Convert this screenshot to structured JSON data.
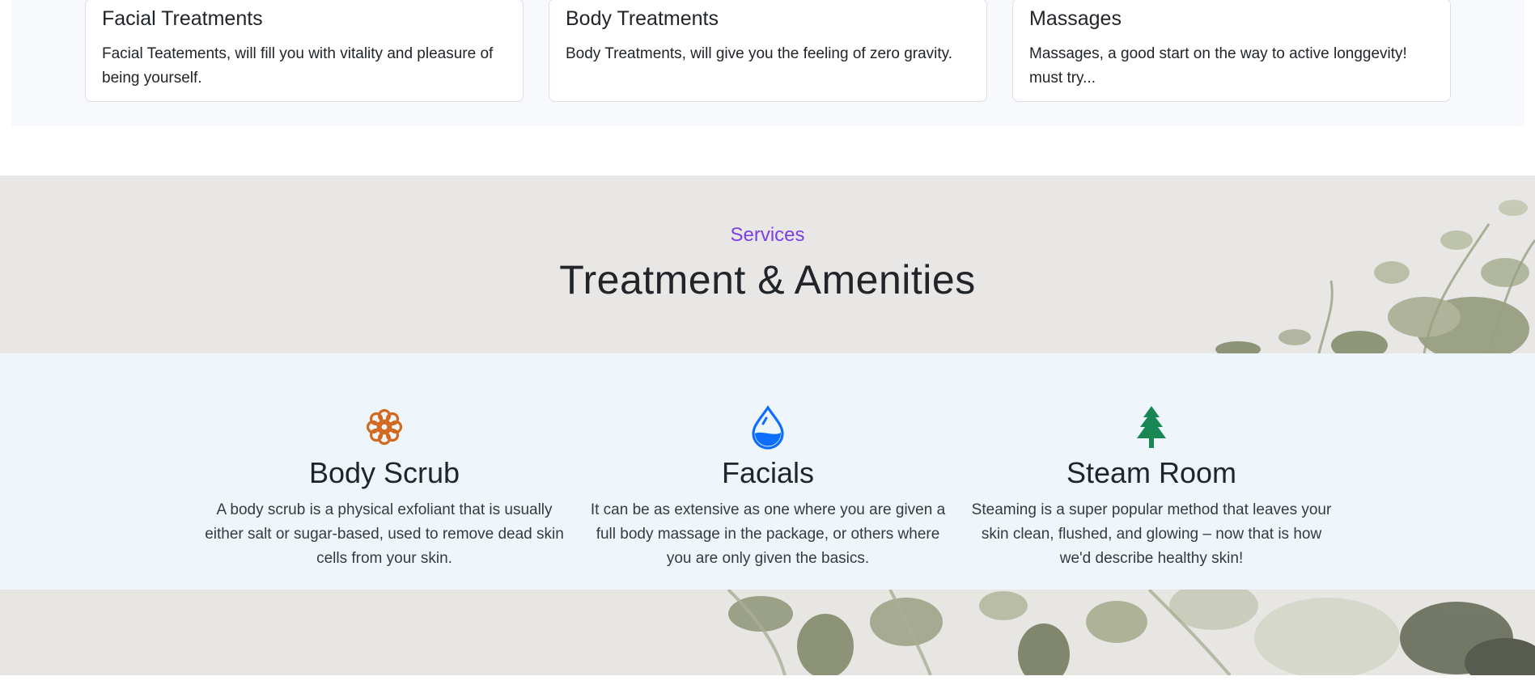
{
  "cards": [
    {
      "title": "Facial Treatments",
      "text": "Facial Teatements, will fill you with vitality and pleasure of being yourself."
    },
    {
      "title": "Body Treatments",
      "text": "Body Treatments, will give you the feeling of zero gravity."
    },
    {
      "title": "Massages",
      "text": "Massages, a good start on the way to active longgevity! must try..."
    }
  ],
  "services": {
    "kicker": "Services",
    "title": "Treatment & Amenities"
  },
  "amenities": [
    {
      "icon": "flower-icon",
      "title": "Body Scrub",
      "text": "A body scrub is a physical exfoliant that is usually either salt or sugar-based, used to remove dead skin cells from your skin."
    },
    {
      "icon": "water-drop-icon",
      "title": "Facials",
      "text": "It can be as extensive as one where you are given a full body massage in the package, or others where you are only given the basics."
    },
    {
      "icon": "tree-icon",
      "title": "Steam Room",
      "text": "Steaming is a super popular method that leaves your skin clean, flushed, and glowing – now that is how we'd describe healthy skin!"
    }
  ],
  "colors": {
    "accent": "#7b3fe4",
    "flower_icon": "#d2691e",
    "drop_icon": "#0d6efd",
    "tree_icon": "#198754",
    "leaf": "#8a9470"
  }
}
